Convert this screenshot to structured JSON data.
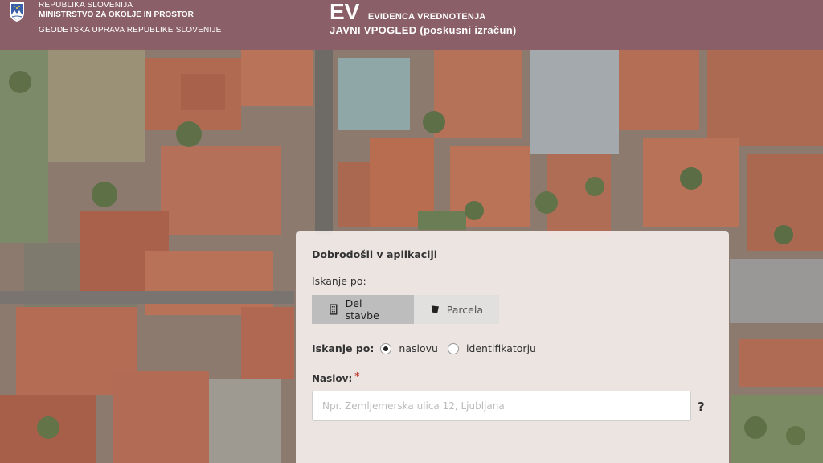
{
  "header": {
    "ministry_line1": "REPUBLIKA SLOVENIJA",
    "ministry_line2": "MINISTRSTVO ZA OKOLJE IN PROSTOR",
    "ministry_line3": "GEODETSKA UPRAVA REPUBLIKE SLOVENIJE",
    "brand_short": "EV",
    "brand_sub": "EVIDENCA VREDNOTENJA",
    "brand_title": "JAVNI VPOGLED (poskusni izračun)",
    "colors": {
      "header_bg": "#8a5f67"
    }
  },
  "panel": {
    "welcome": "Dobrodošli v aplikaciji",
    "search_by_label": "Iskanje po:",
    "tabs": [
      {
        "label": "Del stavbe",
        "icon": "building-icon",
        "active": true
      },
      {
        "label": "Parcela",
        "icon": "parcel-icon",
        "active": false
      }
    ],
    "radio_label": "Iskanje po:",
    "radio_options": [
      {
        "label": "naslovu",
        "selected": true
      },
      {
        "label": "identifikatorju",
        "selected": false
      }
    ],
    "address_label": "Naslov:",
    "address_required_mark": "*",
    "address_placeholder": "Npr. Zemljemerska ulica 12, Ljubljana",
    "address_value": "",
    "help_label": "?"
  },
  "map": {
    "icon": "aerial-map"
  }
}
